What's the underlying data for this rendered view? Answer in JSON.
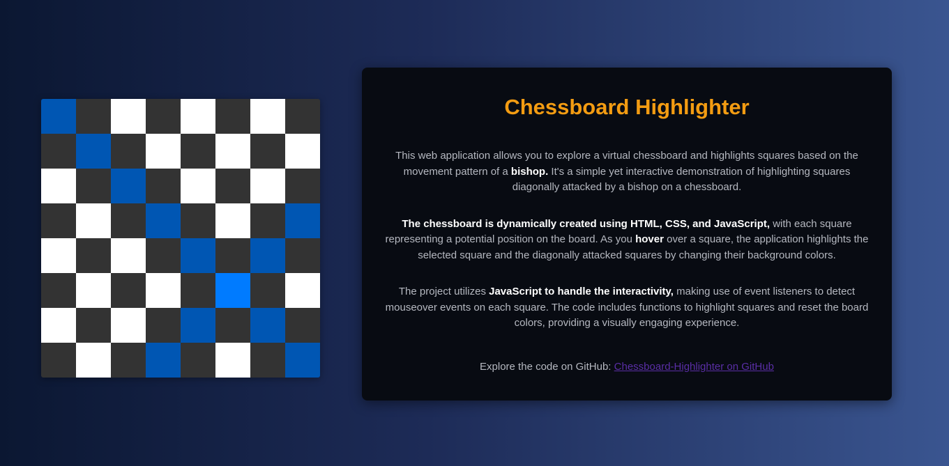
{
  "board": {
    "pattern": [
      [
        "hl",
        "dark",
        "light",
        "dark",
        "light",
        "dark",
        "light",
        "dark"
      ],
      [
        "dark",
        "hl",
        "dark",
        "light",
        "dark",
        "light",
        "dark",
        "light"
      ],
      [
        "light",
        "dark",
        "hl",
        "dark",
        "light",
        "dark",
        "light",
        "dark"
      ],
      [
        "dark",
        "light",
        "dark",
        "hl",
        "dark",
        "light",
        "dark",
        "hl"
      ],
      [
        "light",
        "dark",
        "light",
        "dark",
        "hl",
        "dark",
        "hl",
        "dark"
      ],
      [
        "dark",
        "light",
        "dark",
        "light",
        "dark",
        "sel",
        "dark",
        "light"
      ],
      [
        "light",
        "dark",
        "light",
        "dark",
        "hl",
        "dark",
        "hl",
        "dark"
      ],
      [
        "dark",
        "light",
        "dark",
        "hl",
        "dark",
        "light",
        "dark",
        "hl"
      ]
    ],
    "colors": {
      "light": "#ffffff",
      "dark": "#333333",
      "highlight": "#0056b3",
      "selected": "#007bff"
    }
  },
  "card": {
    "title": "Chessboard Highlighter",
    "p1": {
      "a": "This web application allows you to explore a virtual chessboard and highlights squares based on the movement pattern of a ",
      "b": "bishop.",
      "c": " It's a simple yet interactive demonstration of highlighting squares diagonally attacked by a bishop on a chessboard."
    },
    "p2": {
      "a": "The chessboard is dynamically created using HTML, CSS, and JavaScript,",
      "b": " with each square representing a potential position on the board. As you ",
      "c": "hover",
      "d": " over a square, the application highlights the selected square and the diagonally attacked squares by changing their background colors."
    },
    "p3": {
      "a": "The project utilizes ",
      "b": "JavaScript to handle the interactivity,",
      "c": " making use of event listeners to detect mouseover events on each square. The code includes functions to highlight squares and reset the board colors, providing a visually engaging experience."
    },
    "github": {
      "prefix": "Explore the code on GitHub: ",
      "link": "Chessboard-Highlighter on GitHub"
    },
    "accent": "#f39c12"
  }
}
